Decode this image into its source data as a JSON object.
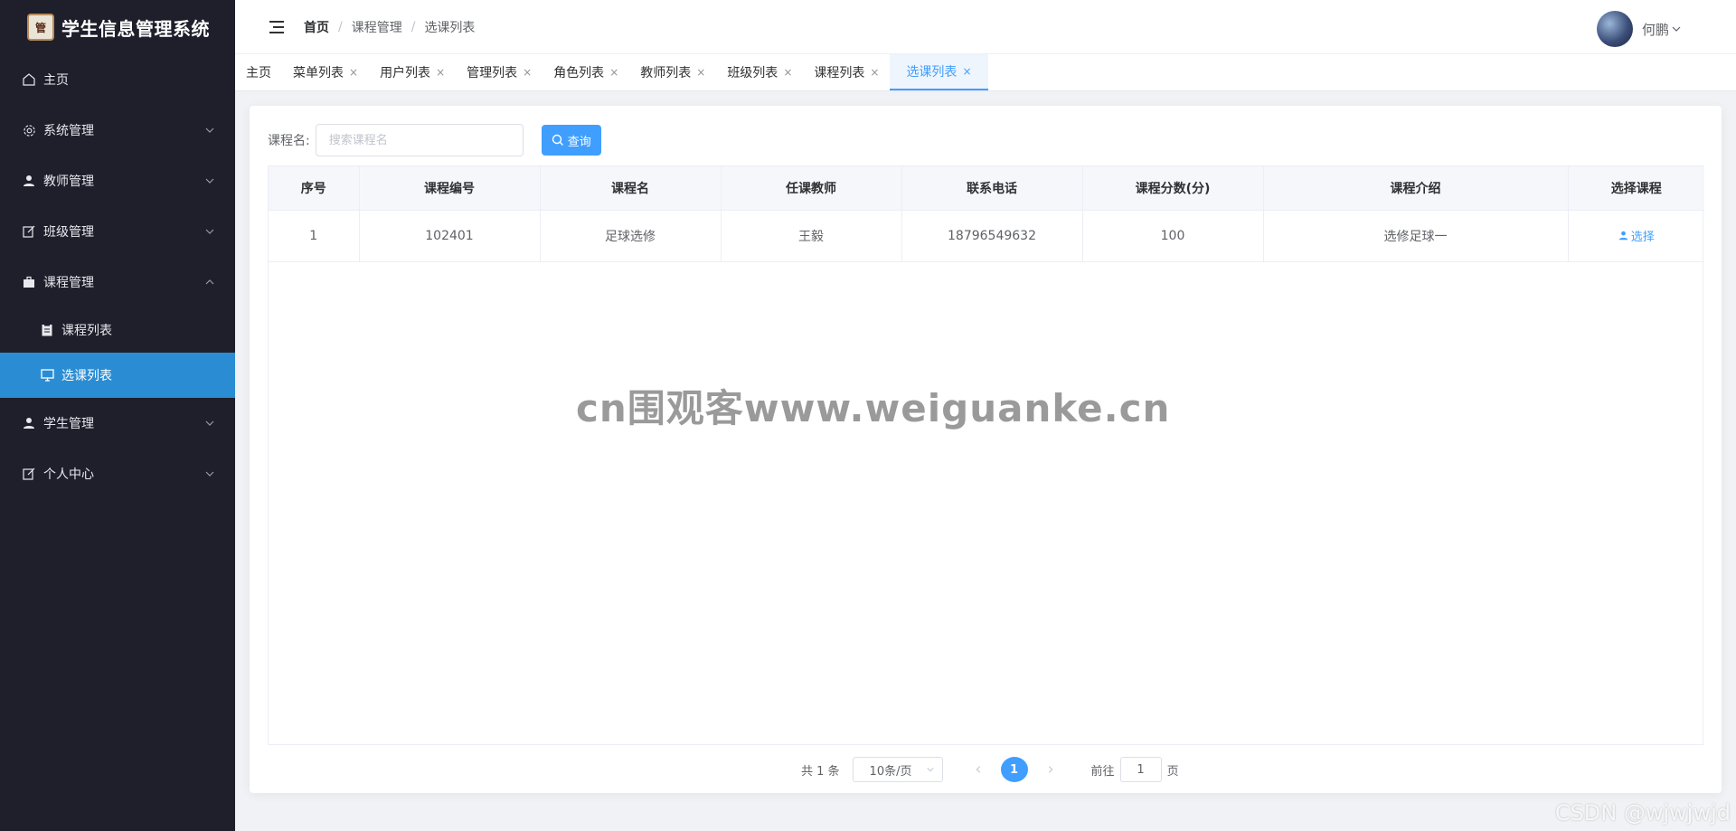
{
  "app": {
    "title": "学生信息管理系统",
    "logo_text": "管"
  },
  "sidebar": {
    "items": [
      {
        "label": "主页",
        "icon": "home-icon",
        "expandable": false
      },
      {
        "label": "系统管理",
        "icon": "gear-icon",
        "expandable": true
      },
      {
        "label": "教师管理",
        "icon": "user-icon",
        "expandable": true
      },
      {
        "label": "班级管理",
        "icon": "edit-icon",
        "expandable": true
      },
      {
        "label": "课程管理",
        "icon": "briefcase-icon",
        "expandable": true,
        "expanded": true
      },
      {
        "label": "学生管理",
        "icon": "user-icon",
        "expandable": true
      },
      {
        "label": "个人中心",
        "icon": "edit-icon",
        "expandable": true
      }
    ],
    "sub_items": [
      {
        "label": "课程列表",
        "icon": "document-icon"
      },
      {
        "label": "选课列表",
        "icon": "monitor-icon",
        "active": true
      }
    ],
    "active_color": "#2a8dd4",
    "bg_color": "#1e1f2b"
  },
  "header": {
    "breadcrumb": [
      "首页",
      "课程管理",
      "选课列表"
    ],
    "separator": "/",
    "username": "何鹏"
  },
  "tabs": [
    {
      "label": "主页",
      "closable": false
    },
    {
      "label": "菜单列表",
      "closable": true
    },
    {
      "label": "用户列表",
      "closable": true
    },
    {
      "label": "管理列表",
      "closable": true
    },
    {
      "label": "角色列表",
      "closable": true
    },
    {
      "label": "教师列表",
      "closable": true
    },
    {
      "label": "班级列表",
      "closable": true
    },
    {
      "label": "课程列表",
      "closable": true
    },
    {
      "label": "选课列表",
      "closable": true,
      "active": true
    }
  ],
  "tab_close_glyph": "×",
  "search": {
    "label": "课程名:",
    "placeholder": "搜索课程名",
    "value": "",
    "button_label": "查询"
  },
  "table": {
    "columns": [
      "序号",
      "课程编号",
      "课程名",
      "任课教师",
      "联系电话",
      "课程分数(分)",
      "课程介绍",
      "选择课程"
    ],
    "rows": [
      {
        "index": "1",
        "code": "102401",
        "name": "足球选修",
        "teacher": "王毅",
        "phone": "18796549632",
        "score": "100",
        "intro": "选修足球一",
        "action": "选择"
      }
    ]
  },
  "pagination": {
    "total_text": "共 1 条",
    "page_size": "10条/页",
    "current_page": "1",
    "goto_prefix": "前往",
    "goto_value": "1",
    "goto_suffix": "页"
  },
  "watermark": "cn围观客www.weiguanke.cn",
  "corner_watermark": "CSDN @wjwjwjd",
  "colors": {
    "primary": "#409eff",
    "sidebar": "#1e1f2b"
  }
}
